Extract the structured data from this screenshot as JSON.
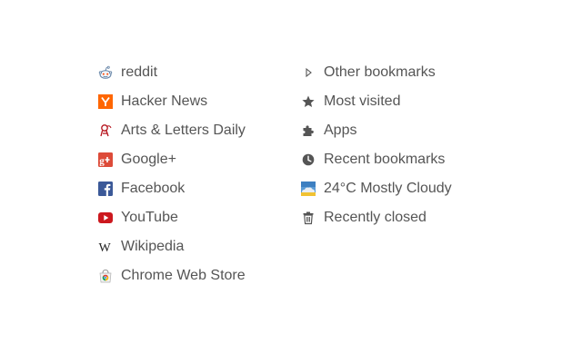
{
  "left_links": [
    {
      "label": "reddit",
      "icon": "reddit-alien-icon"
    },
    {
      "label": "Hacker News",
      "icon": "hacker-news-y-icon"
    },
    {
      "label": "Arts & Letters Daily",
      "icon": "arts-letters-daily-icon"
    },
    {
      "label": "Google+",
      "icon": "google-plus-icon"
    },
    {
      "label": "Facebook",
      "icon": "facebook-f-icon"
    },
    {
      "label": "YouTube",
      "icon": "youtube-play-icon"
    },
    {
      "label": "Wikipedia",
      "icon": "wikipedia-w-icon"
    },
    {
      "label": "Chrome Web Store",
      "icon": "chrome-web-store-icon"
    }
  ],
  "right_links": [
    {
      "label": "Other bookmarks",
      "icon": "triangle-right-icon"
    },
    {
      "label": "Most visited",
      "icon": "star-icon"
    },
    {
      "label": "Apps",
      "icon": "puzzle-piece-icon"
    },
    {
      "label": "Recent bookmarks",
      "icon": "clock-icon"
    },
    {
      "label": "24°C Mostly Cloudy",
      "icon": "weather-cloudy-icon"
    },
    {
      "label": "Recently closed",
      "icon": "trash-icon"
    }
  ],
  "colors": {
    "text": "#555555",
    "hacker_news_orange": "#ff6600",
    "facebook_blue": "#3b5998",
    "youtube_red": "#cc181e",
    "google_plus_red": "#dd4b39"
  }
}
